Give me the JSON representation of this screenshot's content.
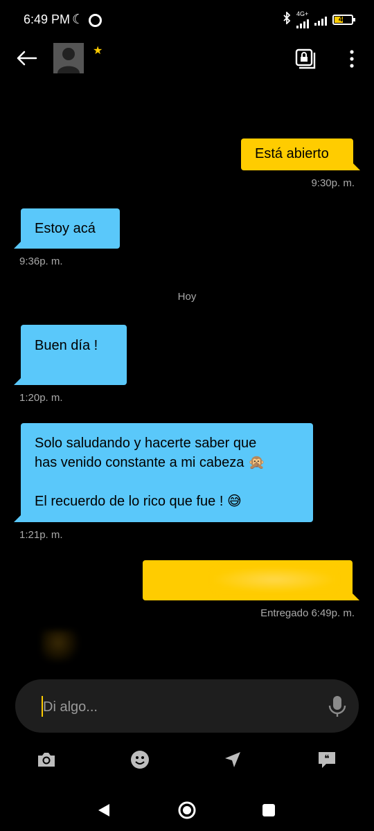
{
  "status_bar": {
    "time": "6:49 PM",
    "network": "4G+",
    "battery": "47",
    "battery_level": 0.47,
    "icons": [
      "moon-icon",
      "ring-icon",
      "bluetooth-icon",
      "signal-icon",
      "battery-icon"
    ]
  },
  "header": {
    "icons": [
      "back-arrow-icon",
      "avatar-placeholder",
      "favorite-star-icon",
      "private-album-icon",
      "more-vert-icon"
    ]
  },
  "messages": [
    {
      "direction": "out",
      "text": "Está abierto",
      "time": "9:30p. m."
    },
    {
      "direction": "in",
      "text": "Estoy acá",
      "time": "9:36p. m."
    },
    {
      "direction": "in",
      "text": "Buen día !",
      "time": "1:20p. m."
    },
    {
      "direction": "in",
      "line1": "Solo saludando y hacerte saber que",
      "line2": "has venido constante a mi cabeza 🙊",
      "line3": "El recuerdo de lo rico que fue ! 😅",
      "time": "1:21p. m."
    },
    {
      "direction": "out",
      "text": "",
      "time": "Entregado 6:49p. m."
    }
  ],
  "day_separator": "Hoy",
  "composer": {
    "placeholder": "Di algo..."
  },
  "toolbar": {
    "icons": [
      "camera-icon",
      "emoji-icon",
      "location-icon",
      "saved-phrases-icon"
    ]
  },
  "navbar": {
    "icons": [
      "back-triangle-icon",
      "home-circle-icon",
      "recents-square-icon"
    ]
  },
  "colors": {
    "outgoing": "#ffcc00",
    "incoming": "#5ac8fa",
    "background": "#000000"
  }
}
